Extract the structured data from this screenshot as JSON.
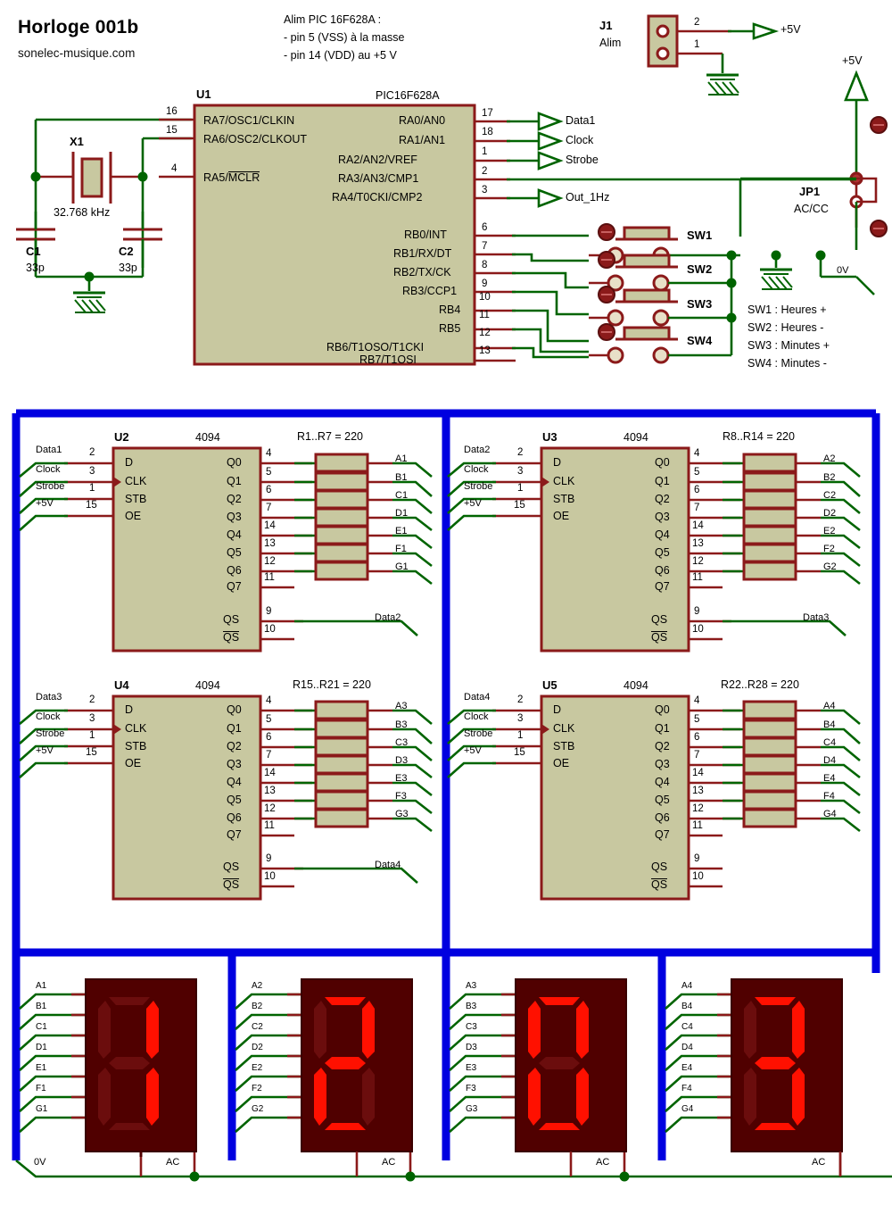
{
  "header": {
    "title": "Horloge 001b",
    "subtitle": "sonelec-musique.com",
    "notes": [
      "Alim PIC 16F628A :",
      "- pin 5 (VSS) à la masse",
      "- pin 14 (VDD) au +5 V"
    ]
  },
  "colors": {
    "wire_green": "#006400",
    "wire_red": "#8b1a1a",
    "bus_blue": "#0000e0",
    "ic_fill": "#c8c8a0",
    "display_body": "#500000",
    "segment_on": "#ff1000",
    "segment_off": "#6b0d0d"
  },
  "j1": {
    "ref": "J1",
    "name": "Alim",
    "pins": [
      "2",
      "1"
    ],
    "out_label": "+5V"
  },
  "rail": {
    "label": "+5V"
  },
  "jp1": {
    "ref": "JP1",
    "name": "AC/CC",
    "zero_label": "0V"
  },
  "u1": {
    "ref": "U1",
    "device": "PIC16F628A",
    "left_pins": [
      {
        "num": "16",
        "name": "RA7/OSC1/CLKIN"
      },
      {
        "num": "15",
        "name": "RA6/OSC2/CLKOUT"
      },
      {
        "num": "4",
        "name": "RA5/MCLR",
        "overline": "MCLR",
        "prefix": "RA5/"
      }
    ],
    "right_pins_a": [
      {
        "num": "17",
        "name": "RA0/AN0"
      },
      {
        "num": "18",
        "name": "RA1/AN1"
      },
      {
        "num": "1",
        "name": "RA2/AN2/VREF"
      },
      {
        "num": "2",
        "name": "RA3/AN3/CMP1"
      },
      {
        "num": "3",
        "name": "RA4/T0CKI/CMP2"
      }
    ],
    "right_pins_b": [
      {
        "num": "6",
        "name": "RB0/INT"
      },
      {
        "num": "7",
        "name": "RB1/RX/DT"
      },
      {
        "num": "8",
        "name": "RB2/TX/CK"
      },
      {
        "num": "9",
        "name": "RB3/CCP1"
      },
      {
        "num": "10",
        "name": "RB4"
      },
      {
        "num": "11",
        "name": "RB5"
      },
      {
        "num": "12",
        "name": "RB6/T1OSO/T1CKI"
      },
      {
        "num": "13",
        "name": "RB7/T1OSI"
      }
    ],
    "outputs": [
      "Data1",
      "Clock",
      "Strobe",
      "Out_1Hz"
    ]
  },
  "xtal": {
    "ref": "X1",
    "value": "32.768 kHz",
    "caps": [
      {
        "ref": "C1",
        "value": "33p"
      },
      {
        "ref": "C2",
        "value": "33p"
      }
    ]
  },
  "switches": {
    "items": [
      "SW1",
      "SW2",
      "SW3",
      "SW4"
    ],
    "legend": [
      "SW1 : Heures +",
      "SW2 : Heures -",
      "SW3 : Minutes +",
      "SW4 : Minutes -"
    ]
  },
  "shift_registers": [
    {
      "ref": "U2",
      "device": "4094",
      "resistors": "R1..R7 = 220",
      "inputs": [
        {
          "label": "Data1",
          "num": "2",
          "pin": "D"
        },
        {
          "label": "Clock",
          "num": "3",
          "pin": "CLK"
        },
        {
          "label": "Strobe",
          "num": "1",
          "pin": "STB"
        },
        {
          "label": "+5V",
          "num": "15",
          "pin": "OE"
        }
      ],
      "outputs": [
        {
          "pin": "Q0",
          "num": "4",
          "net": "A1"
        },
        {
          "pin": "Q1",
          "num": "5",
          "net": "B1"
        },
        {
          "pin": "Q2",
          "num": "6",
          "net": "C1"
        },
        {
          "pin": "Q3",
          "num": "7",
          "net": "D1"
        },
        {
          "pin": "Q4",
          "num": "14",
          "net": "E1"
        },
        {
          "pin": "Q5",
          "num": "13",
          "net": "F1"
        },
        {
          "pin": "Q6",
          "num": "12",
          "net": "G1"
        },
        {
          "pin": "Q7",
          "num": "11",
          "net": ""
        }
      ],
      "serial": [
        {
          "pin": "QS",
          "num": "9",
          "net": "Data2",
          "overline": false
        },
        {
          "pin": "QS",
          "num": "10",
          "net": "",
          "overline": true
        }
      ]
    },
    {
      "ref": "U3",
      "device": "4094",
      "resistors": "R8..R14 = 220",
      "inputs": [
        {
          "label": "Data2",
          "num": "2",
          "pin": "D"
        },
        {
          "label": "Clock",
          "num": "3",
          "pin": "CLK"
        },
        {
          "label": "Strobe",
          "num": "1",
          "pin": "STB"
        },
        {
          "label": "+5V",
          "num": "15",
          "pin": "OE"
        }
      ],
      "outputs": [
        {
          "pin": "Q0",
          "num": "4",
          "net": "A2"
        },
        {
          "pin": "Q1",
          "num": "5",
          "net": "B2"
        },
        {
          "pin": "Q2",
          "num": "6",
          "net": "C2"
        },
        {
          "pin": "Q3",
          "num": "7",
          "net": "D2"
        },
        {
          "pin": "Q4",
          "num": "14",
          "net": "E2"
        },
        {
          "pin": "Q5",
          "num": "13",
          "net": "F2"
        },
        {
          "pin": "Q6",
          "num": "12",
          "net": "G2"
        },
        {
          "pin": "Q7",
          "num": "11",
          "net": ""
        }
      ],
      "serial": [
        {
          "pin": "QS",
          "num": "9",
          "net": "Data3",
          "overline": false
        },
        {
          "pin": "QS",
          "num": "10",
          "net": "",
          "overline": true
        }
      ]
    },
    {
      "ref": "U4",
      "device": "4094",
      "resistors": "R15..R21 = 220",
      "inputs": [
        {
          "label": "Data3",
          "num": "2",
          "pin": "D"
        },
        {
          "label": "Clock",
          "num": "3",
          "pin": "CLK"
        },
        {
          "label": "Strobe",
          "num": "1",
          "pin": "STB"
        },
        {
          "label": "+5V",
          "num": "15",
          "pin": "OE"
        }
      ],
      "outputs": [
        {
          "pin": "Q0",
          "num": "4",
          "net": "A3"
        },
        {
          "pin": "Q1",
          "num": "5",
          "net": "B3"
        },
        {
          "pin": "Q2",
          "num": "6",
          "net": "C3"
        },
        {
          "pin": "Q3",
          "num": "7",
          "net": "D3"
        },
        {
          "pin": "Q4",
          "num": "14",
          "net": "E3"
        },
        {
          "pin": "Q5",
          "num": "13",
          "net": "F3"
        },
        {
          "pin": "Q6",
          "num": "12",
          "net": "G3"
        },
        {
          "pin": "Q7",
          "num": "11",
          "net": ""
        }
      ],
      "serial": [
        {
          "pin": "QS",
          "num": "9",
          "net": "Data4",
          "overline": false
        },
        {
          "pin": "QS",
          "num": "10",
          "net": "",
          "overline": true
        }
      ]
    },
    {
      "ref": "U5",
      "device": "4094",
      "resistors": "R22..R28 = 220",
      "inputs": [
        {
          "label": "Data4",
          "num": "2",
          "pin": "D"
        },
        {
          "label": "Clock",
          "num": "3",
          "pin": "CLK"
        },
        {
          "label": "Strobe",
          "num": "1",
          "pin": "STB"
        },
        {
          "label": "+5V",
          "num": "15",
          "pin": "OE"
        }
      ],
      "outputs": [
        {
          "pin": "Q0",
          "num": "4",
          "net": "A4"
        },
        {
          "pin": "Q1",
          "num": "5",
          "net": "B4"
        },
        {
          "pin": "Q2",
          "num": "6",
          "net": "C4"
        },
        {
          "pin": "Q3",
          "num": "7",
          "net": "D4"
        },
        {
          "pin": "Q4",
          "num": "14",
          "net": "E4"
        },
        {
          "pin": "Q5",
          "num": "13",
          "net": "F4"
        },
        {
          "pin": "Q6",
          "num": "12",
          "net": "G4"
        },
        {
          "pin": "Q7",
          "num": "11",
          "net": ""
        }
      ],
      "serial": [
        {
          "pin": "QS",
          "num": "9",
          "net": "",
          "overline": false
        },
        {
          "pin": "QS",
          "num": "10",
          "net": "",
          "overline": true
        }
      ]
    }
  ],
  "displays": [
    {
      "digit": "1",
      "segments": [
        "b",
        "c"
      ],
      "nets": [
        "A1",
        "B1",
        "C1",
        "D1",
        "E1",
        "F1",
        "G1"
      ],
      "common": "AC"
    },
    {
      "digit": "2",
      "segments": [
        "a",
        "b",
        "g",
        "e",
        "d"
      ],
      "nets": [
        "A2",
        "B2",
        "C2",
        "D2",
        "E2",
        "F2",
        "G2"
      ],
      "common": "AC"
    },
    {
      "digit": "0",
      "segments": [
        "a",
        "b",
        "c",
        "d",
        "e",
        "f"
      ],
      "nets": [
        "A3",
        "B3",
        "C3",
        "D3",
        "E3",
        "F3",
        "G3"
      ],
      "common": "AC"
    },
    {
      "digit": "3",
      "segments": [
        "a",
        "b",
        "c",
        "d",
        "g"
      ],
      "nets": [
        "A4",
        "B4",
        "C4",
        "D4",
        "E4",
        "F4",
        "G4"
      ],
      "common": "AC"
    }
  ],
  "ground_net": {
    "label": "0V"
  }
}
